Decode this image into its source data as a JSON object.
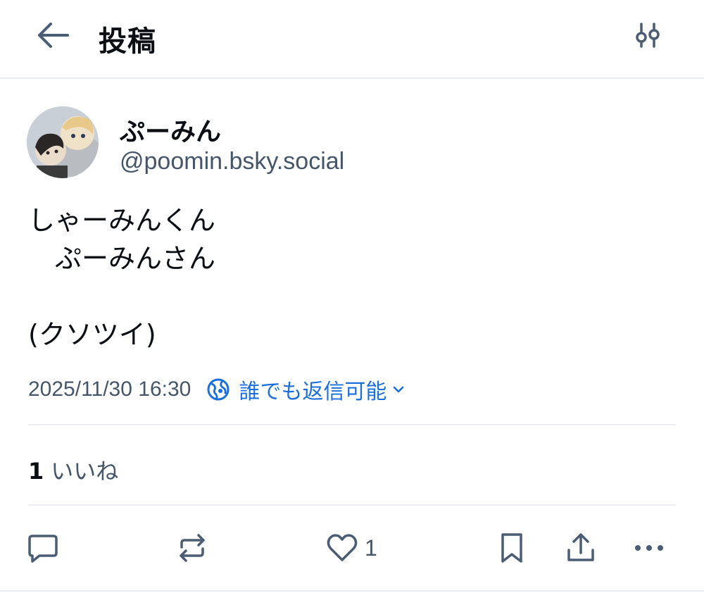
{
  "header": {
    "title": "投稿",
    "back_icon": "arrow-left-icon",
    "filter_icon": "sliders-icon"
  },
  "author": {
    "display_name": "ぷーみん",
    "handle": "@poomin.bsky.social"
  },
  "post": {
    "text": "しゃーみんくん\n　ぷーみんさん\n\n(クソツイ)",
    "timestamp": "2025/11/30 16:30",
    "reply_setting": "誰でも返信可能"
  },
  "stats": {
    "likes_count": "1",
    "likes_label": "いいね"
  },
  "actions": {
    "reply_icon": "comment-icon",
    "repost_icon": "repost-icon",
    "like_icon": "heart-icon",
    "like_count": "1",
    "bookmark_icon": "bookmark-icon",
    "share_icon": "share-icon",
    "more_icon": "more-dots-icon"
  },
  "colors": {
    "accent": "#1b6fdd",
    "muted_text": "#46566a",
    "icon": "#4a5d74",
    "divider": "#e9edf1"
  }
}
